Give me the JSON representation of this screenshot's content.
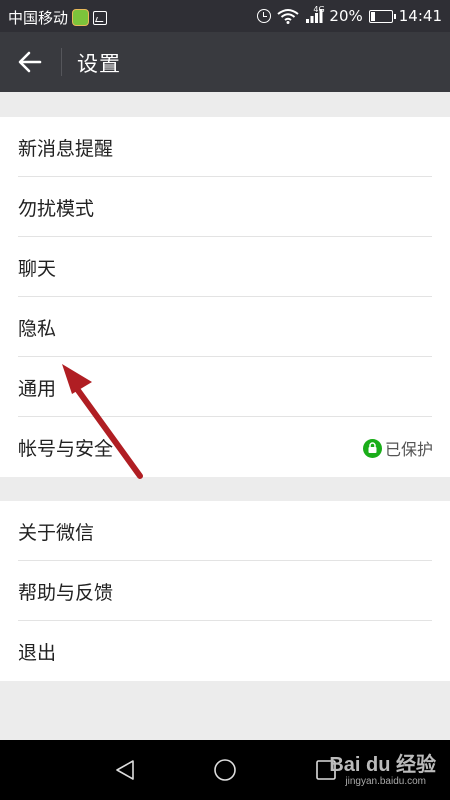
{
  "status_bar": {
    "carrier": "中国移动",
    "network_badge": "4G",
    "battery_percent": "20%",
    "battery_level": 0.2,
    "time": "14:41"
  },
  "header": {
    "back_icon": "back-arrow-icon",
    "title": "设置"
  },
  "settings_group_1": [
    {
      "label": "新消息提醒"
    },
    {
      "label": "勿扰模式"
    },
    {
      "label": "聊天"
    },
    {
      "label": "隐私"
    },
    {
      "label": "通用"
    },
    {
      "label": "帐号与安全",
      "status": "已保护",
      "status_icon": "lock-icon",
      "status_color": "#1aad19"
    }
  ],
  "settings_group_2": [
    {
      "label": "关于微信"
    },
    {
      "label": "帮助与反馈"
    },
    {
      "label": "退出"
    }
  ],
  "nav_bar": {
    "back": "nav-back-icon",
    "home": "nav-home-icon",
    "recents": "nav-recents-icon"
  },
  "watermark": {
    "brand": "Bai du 经验",
    "url": "jingyan.baidu.com"
  },
  "colors": {
    "titlebar": "#393a3f",
    "statusbar": "#2f2f35",
    "background": "#ececec",
    "accent_green": "#1aad19",
    "annotation": "#b01e23"
  }
}
